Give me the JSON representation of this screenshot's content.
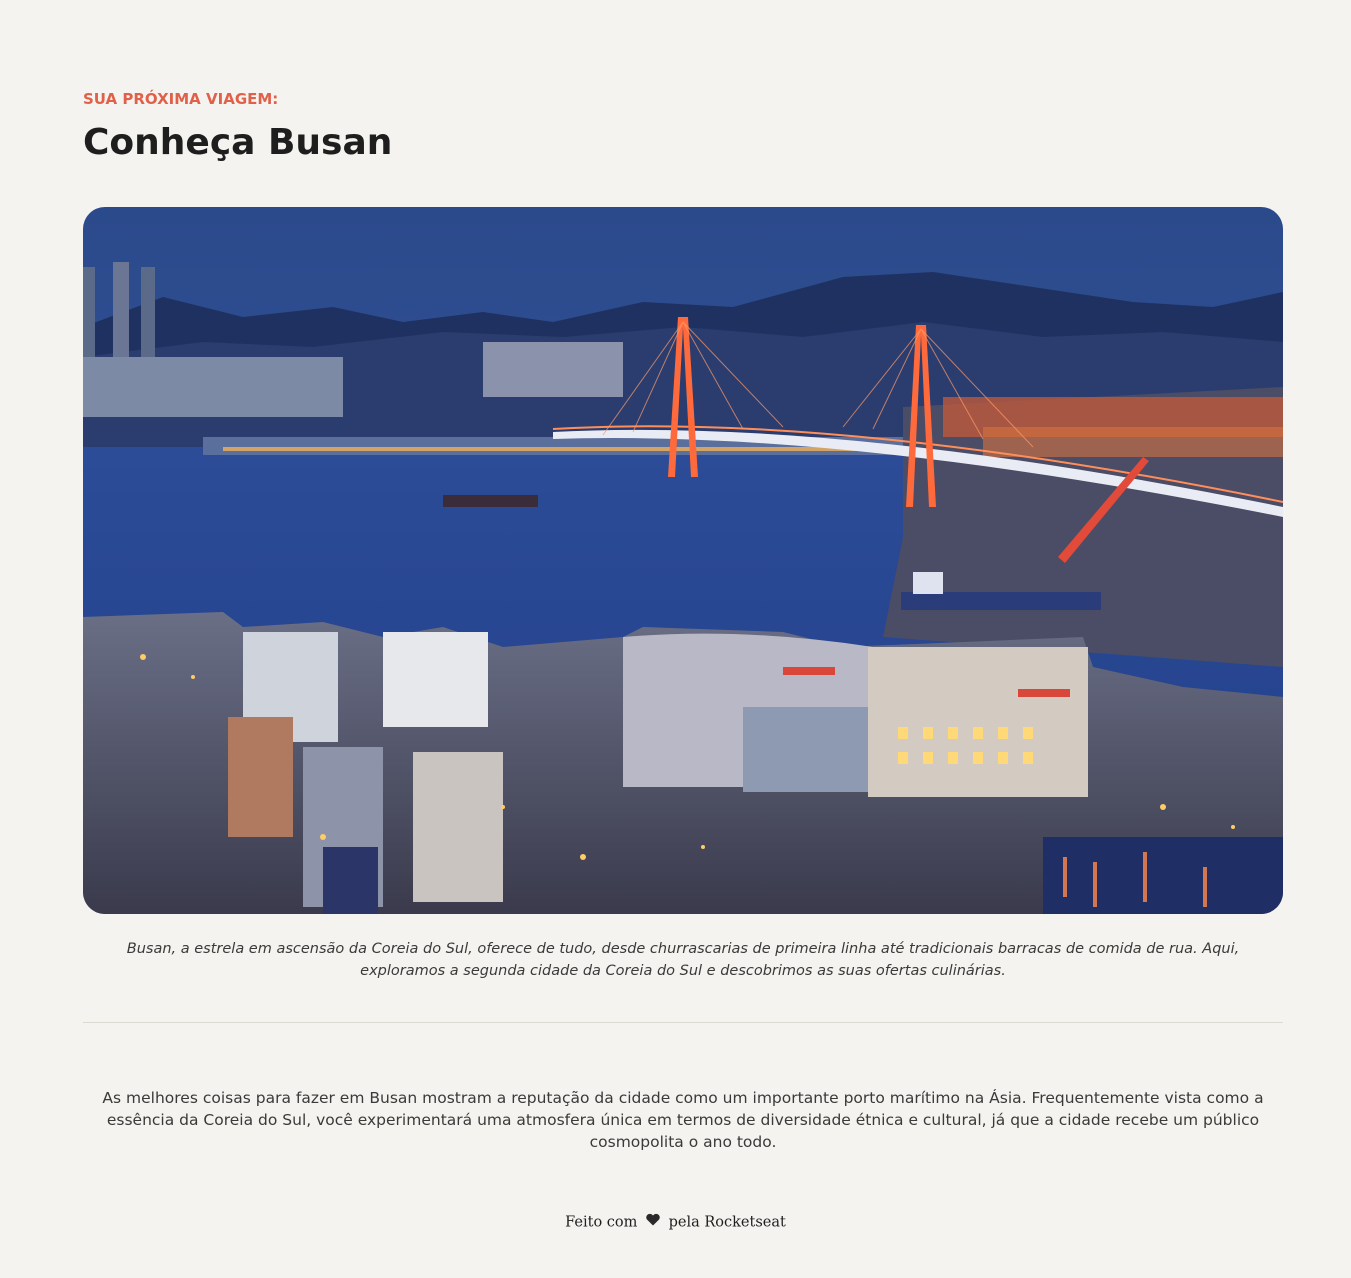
{
  "header": {
    "eyebrow": "SUA PRÓXIMA VIAGEM:",
    "title": "Conheça Busan"
  },
  "hero": {
    "icon": "busan-harbor-photo"
  },
  "caption": "Busan, a estrela em ascensão da Coreia do Sul, oferece de tudo, desde churrascarias de primeira linha até tradicionais barracas de comida de rua. Aqui, exploramos a segunda cidade da Coreia do Sul e descobrimos as suas ofertas culinárias.",
  "body": "As melhores coisas para fazer em Busan mostram a reputação da cidade como um importante porto marítimo na Ásia. Frequentemente vista como a essência da Coreia do Sul, você experimentará uma atmosfera única em termos de diversidade étnica e cultural, já que a cidade recebe um público cosmopolita o ano todo.",
  "footer": {
    "prefix": "Feito com",
    "suffix": "pela Rocketseat",
    "icon": "heart-icon"
  },
  "colors": {
    "background": "#f5f3ef",
    "accent": "#e0604a",
    "text": "#1e1e1e"
  }
}
